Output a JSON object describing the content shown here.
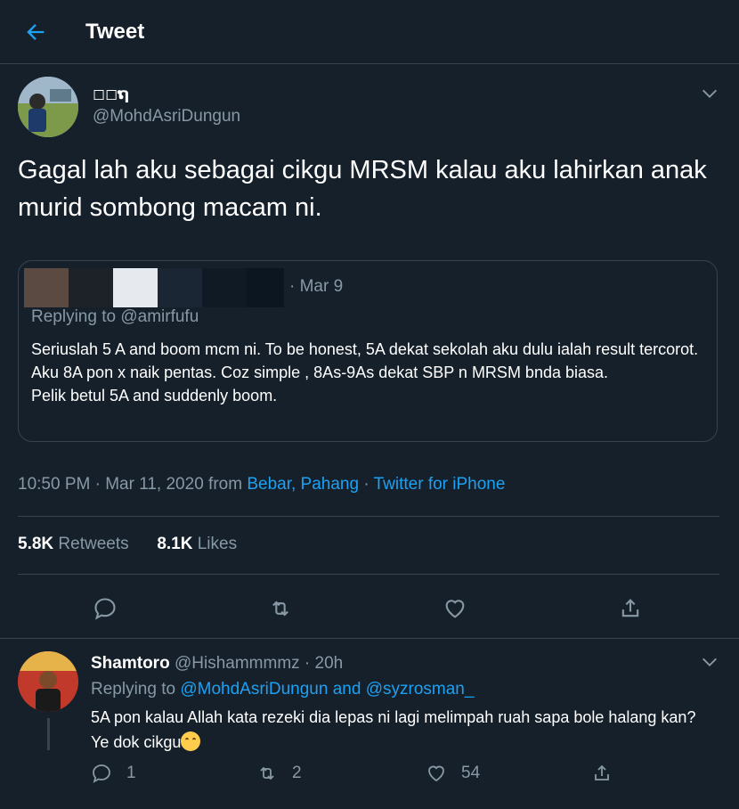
{
  "header": {
    "title": "Tweet"
  },
  "tweet": {
    "author_name": "◻◻ຖ",
    "author_handle": "@MohdAsriDungun",
    "text": "Gagal lah aku sebagai cikgu MRSM kalau aku lahirkan anak murid sombong macam ni.",
    "quote": {
      "date": "· Mar 9",
      "replying_to": "Replying to @amirfufu",
      "text": "Seriuslah 5 A and boom mcm ni. To be honest, 5A dekat sekolah aku dulu ialah result tercorot. Aku 8A pon x naik pentas. Coz simple , 8As-9As dekat SBP n MRSM bnda biasa.\nPelik betul 5A and suddenly boom."
    },
    "meta": {
      "time": "10:50 PM · Mar 11, 2020 from ",
      "location": "Bebar, Pahang",
      "separator": " · ",
      "source": "Twitter for iPhone"
    },
    "stats": {
      "retweets_count": "5.8K",
      "retweets_label": "Retweets",
      "likes_count": "8.1K",
      "likes_label": "Likes"
    }
  },
  "reply": {
    "name": "Shamtoro",
    "handle_time": "@Hishammmmz · 20h",
    "replying_prefix": "Replying to ",
    "replying_user1": "@MohdAsriDungun",
    "replying_and": " and ",
    "replying_user2": "@syzrosman_",
    "text": "5A pon kalau Allah kata rezeki dia lepas ni lagi melimpah ruah sapa bole halang kan? Ye dok cikgu",
    "reply_count": "1",
    "retweet_count": "2",
    "like_count": "54"
  },
  "colors": {
    "background": "#15202b",
    "accent": "#1da1f2",
    "secondary_text": "#8899a6",
    "divider": "#38444d"
  },
  "icons": [
    "back-arrow-icon",
    "chevron-down-icon",
    "reply-icon",
    "retweet-icon",
    "like-icon",
    "share-icon"
  ]
}
